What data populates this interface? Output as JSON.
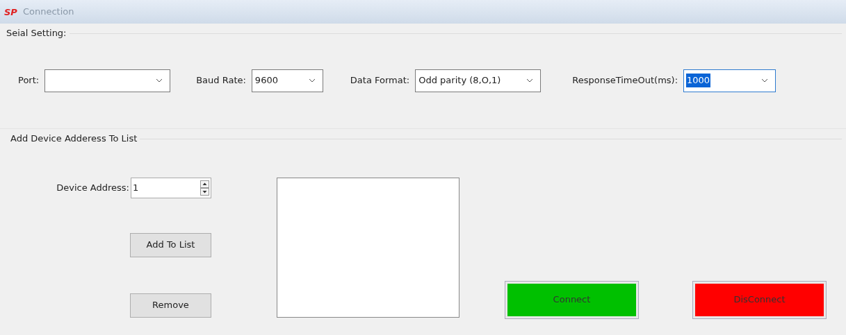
{
  "window": {
    "title": "Connection",
    "logo": "SP"
  },
  "serial_setting": {
    "title": "Seial Setting:",
    "fields": [
      {
        "label": "Port:",
        "focused": false
      },
      {
        "label": "Baud Rate:",
        "value": "9600",
        "focused": false
      },
      {
        "label": "Data Format:",
        "value": "Odd parity (8,O,1)",
        "focused": false
      },
      {
        "label": "ResponseTimeOut(ms):",
        "value": "1000",
        "focused": true
      }
    ]
  },
  "device_list": {
    "title": "Add Device Adderess To List",
    "address_label": "Device Address:",
    "address_value": "1",
    "add_button": "Add To List",
    "remove_button": "Remove"
  },
  "actions": [
    {
      "label": "Connect",
      "color": "#00c000"
    },
    {
      "label": "DisConnect",
      "color": "#ff0000"
    }
  ]
}
